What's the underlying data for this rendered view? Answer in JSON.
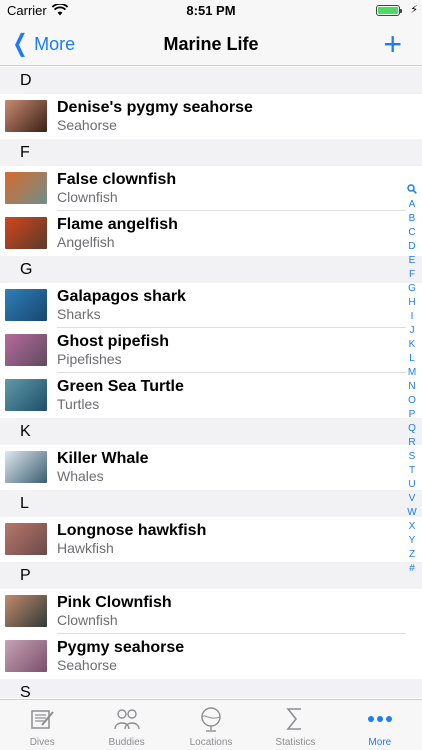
{
  "status": {
    "carrier": "Carrier",
    "time": "8:51 PM"
  },
  "nav": {
    "back_label": "More",
    "title": "Marine Life",
    "add_label": "+"
  },
  "sections": [
    {
      "letter": "D",
      "items": [
        {
          "title": "Denise's pygmy seahorse",
          "subtitle": "Seahorse",
          "thumb": [
            "#c98a6f",
            "#3a2018"
          ]
        }
      ]
    },
    {
      "letter": "F",
      "items": [
        {
          "title": "False clownfish",
          "subtitle": "Clownfish",
          "thumb": [
            "#d86b2c",
            "#6e8f8a"
          ]
        },
        {
          "title": "Flame angelfish",
          "subtitle": "Angelfish",
          "thumb": [
            "#d2461e",
            "#5a3a2a"
          ]
        }
      ]
    },
    {
      "letter": "G",
      "items": [
        {
          "title": "Galapagos shark",
          "subtitle": "Sharks",
          "thumb": [
            "#2f7fb8",
            "#17466e"
          ]
        },
        {
          "title": "Ghost pipefish",
          "subtitle": "Pipefishes",
          "thumb": [
            "#b86aa0",
            "#5e4a5c"
          ]
        },
        {
          "title": "Green Sea Turtle",
          "subtitle": "Turtles",
          "thumb": [
            "#5f9aa8",
            "#1f4e6a"
          ]
        }
      ]
    },
    {
      "letter": "K",
      "items": [
        {
          "title": "Killer Whale",
          "subtitle": "Whales",
          "thumb": [
            "#dfe8ee",
            "#3b5d72"
          ]
        }
      ]
    },
    {
      "letter": "L",
      "items": [
        {
          "title": "Longnose hawkfish",
          "subtitle": "Hawkfish",
          "thumb": [
            "#b8776a",
            "#6a4a48"
          ]
        }
      ]
    },
    {
      "letter": "P",
      "items": [
        {
          "title": "Pink Clownfish",
          "subtitle": "Clownfish",
          "thumb": [
            "#c58a6a",
            "#2f3a3a"
          ]
        },
        {
          "title": "Pygmy seahorse",
          "subtitle": "Seahorse",
          "thumb": [
            "#c7a3b6",
            "#7a4f6a"
          ]
        }
      ]
    },
    {
      "letter": "S",
      "items": []
    }
  ],
  "index": [
    "search-icon",
    "A",
    "B",
    "C",
    "D",
    "E",
    "F",
    "G",
    "H",
    "I",
    "J",
    "K",
    "L",
    "M",
    "N",
    "O",
    "P",
    "Q",
    "R",
    "S",
    "T",
    "U",
    "V",
    "W",
    "X",
    "Y",
    "Z",
    "#"
  ],
  "tabs": [
    {
      "label": "Dives",
      "icon": "logbook-icon"
    },
    {
      "label": "Buddies",
      "icon": "people-icon"
    },
    {
      "label": "Locations",
      "icon": "globe-icon"
    },
    {
      "label": "Statistics",
      "icon": "sigma-icon"
    },
    {
      "label": "More",
      "icon": "more-dots-icon",
      "active": true
    }
  ],
  "colors": {
    "accent": "#1b7cf5",
    "inactive_tab": "#8e8e93",
    "battery": "#4cd964"
  }
}
